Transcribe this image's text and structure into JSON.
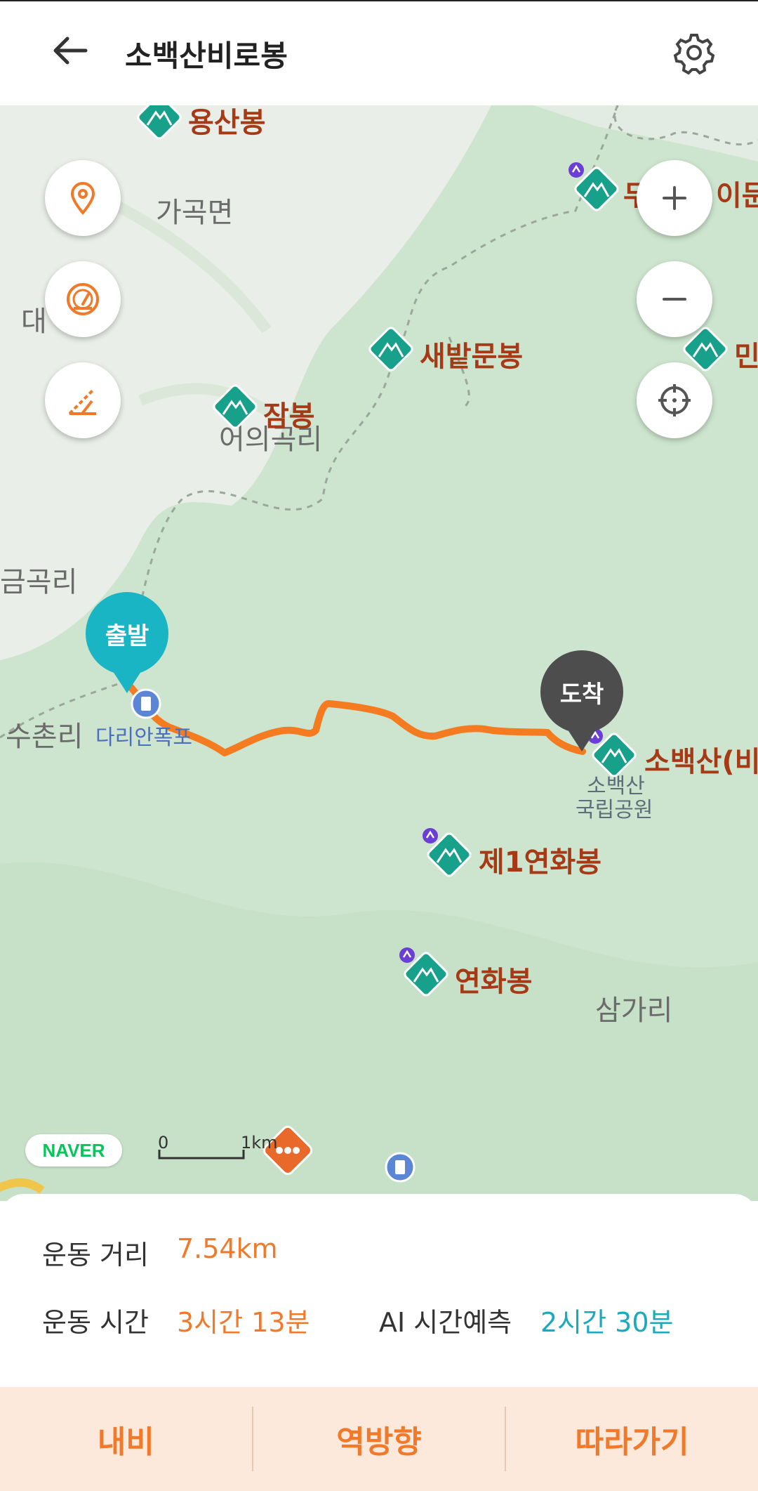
{
  "header": {
    "title": "소백산비로봉"
  },
  "map": {
    "labels": {
      "gagok": "가곡면",
      "eoeuigok": "어의곡리",
      "geumgok": "금곡리",
      "suchon": "수촌리",
      "samga": "삼가리",
      "dae": "대",
      "gongwon_1": "소백산",
      "gongwon_2": "국립공원"
    },
    "peaks": {
      "yongsan": "용산봉",
      "saebat": "새밭문봉",
      "jam": "잠봉",
      "sobaek": "소백산(비",
      "yeonhwa1": "제1연화봉",
      "yeonhwa": "연화봉",
      "du": "두",
      "du_tail": "이문",
      "min": "민"
    },
    "poi": {
      "darian": "다리안폭포"
    },
    "pins": {
      "start": "출발",
      "end": "도착"
    },
    "brand": "NAVER",
    "scale": {
      "zero": "0",
      "unit": "1km"
    }
  },
  "stats": {
    "distance_label": "운동 거리",
    "distance_value": "7.54km",
    "time_label": "운동 시간",
    "time_value": "3시간 13분",
    "ai_label": "AI 시간예측",
    "ai_value": "2시간 30분"
  },
  "actions": {
    "navi": "내비",
    "reverse": "역방향",
    "follow": "따라가기"
  },
  "colors": {
    "accent": "#f07a2a",
    "cyan": "#1ba9bf",
    "peak_teal": "#17a08a",
    "route": "#f47b20"
  }
}
